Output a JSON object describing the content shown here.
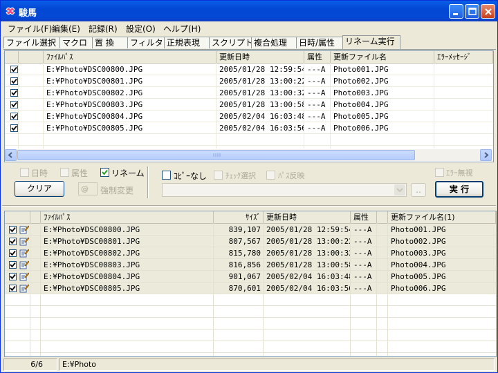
{
  "window": {
    "title": "駿馬",
    "icon": "app-logo-icon"
  },
  "menu": [
    "ファイル(F)",
    "編集(E)",
    "記録(R)",
    "設定(O)",
    "ヘルプ(H)"
  ],
  "tabs": [
    "ファイル選択",
    "マクロ",
    "置 換",
    "フィルタ",
    "正規表現",
    "スクリプト",
    "複合処理",
    "日時/属性",
    "リネーム実行"
  ],
  "active_tab": 8,
  "top_list": {
    "headers": [
      "",
      "ﾌｧｲﾙﾊﾟｽ",
      "更新日時",
      "属性",
      "更新ファイル名",
      "ｴﾗｰﾒｯｾｰｼﾞ"
    ],
    "rows": [
      {
        "checked": true,
        "path": "E:¥Photo¥DSC00800.JPG",
        "date": "2005/01/28 12:59:54",
        "attr": "---A",
        "newname": "Photo001.JPG",
        "error": ""
      },
      {
        "checked": true,
        "path": "E:¥Photo¥DSC00801.JPG",
        "date": "2005/01/28 13:00:22",
        "attr": "---A",
        "newname": "Photo002.JPG",
        "error": ""
      },
      {
        "checked": true,
        "path": "E:¥Photo¥DSC00802.JPG",
        "date": "2005/01/28 13:00:32",
        "attr": "---A",
        "newname": "Photo003.JPG",
        "error": ""
      },
      {
        "checked": true,
        "path": "E:¥Photo¥DSC00803.JPG",
        "date": "2005/01/28 13:00:58",
        "attr": "---A",
        "newname": "Photo004.JPG",
        "error": ""
      },
      {
        "checked": true,
        "path": "E:¥Photo¥DSC00804.JPG",
        "date": "2005/02/04 16:03:48",
        "attr": "---A",
        "newname": "Photo005.JPG",
        "error": ""
      },
      {
        "checked": true,
        "path": "E:¥Photo¥DSC00805.JPG",
        "date": "2005/02/04 16:03:56",
        "attr": "---A",
        "newname": "Photo006.JPG",
        "error": ""
      }
    ]
  },
  "controls": {
    "opt_datetime": "日時",
    "opt_attr": "属性",
    "opt_rename": "リネーム",
    "opt_rename_checked": true,
    "clear_label": "クリア",
    "force_prefix": "@",
    "force_label": "強制変更",
    "copy_none": "ｺﾋﾟｰなし",
    "check_select": "ﾁｪｯｸ選択",
    "path_reflect": "ﾊﾟｽ反映",
    "ignore_error": "ｴﾗｰ無視",
    "browse_label": "..",
    "run_label": "実 行"
  },
  "bottom_list": {
    "headers": [
      "",
      "ﾌｧｲﾙﾊﾟｽ",
      "ｻｲｽﾞ",
      "更新日時",
      "属性",
      "",
      "更新ファイル名(1)"
    ],
    "rows": [
      {
        "checked": true,
        "path": "E:¥Photo¥DSC00800.JPG",
        "size": "839,107",
        "date": "2005/01/28 12:59:54",
        "attr": "---A",
        "newname": "Photo001.JPG"
      },
      {
        "checked": true,
        "path": "E:¥Photo¥DSC00801.JPG",
        "size": "807,567",
        "date": "2005/01/28 13:00:22",
        "attr": "---A",
        "newname": "Photo002.JPG"
      },
      {
        "checked": true,
        "path": "E:¥Photo¥DSC00802.JPG",
        "size": "815,780",
        "date": "2005/01/28 13:00:32",
        "attr": "---A",
        "newname": "Photo003.JPG"
      },
      {
        "checked": true,
        "path": "E:¥Photo¥DSC00803.JPG",
        "size": "816,856",
        "date": "2005/01/28 13:00:58",
        "attr": "---A",
        "newname": "Photo004.JPG"
      },
      {
        "checked": true,
        "path": "E:¥Photo¥DSC00804.JPG",
        "size": "901,067",
        "date": "2005/02/04 16:03:48",
        "attr": "---A",
        "newname": "Photo005.JPG"
      },
      {
        "checked": true,
        "path": "E:¥Photo¥DSC00805.JPG",
        "size": "870,601",
        "date": "2005/02/04 16:03:56",
        "attr": "---A",
        "newname": "Photo006.JPG"
      }
    ]
  },
  "status": {
    "count": "6/6",
    "path": "E:¥Photo"
  }
}
